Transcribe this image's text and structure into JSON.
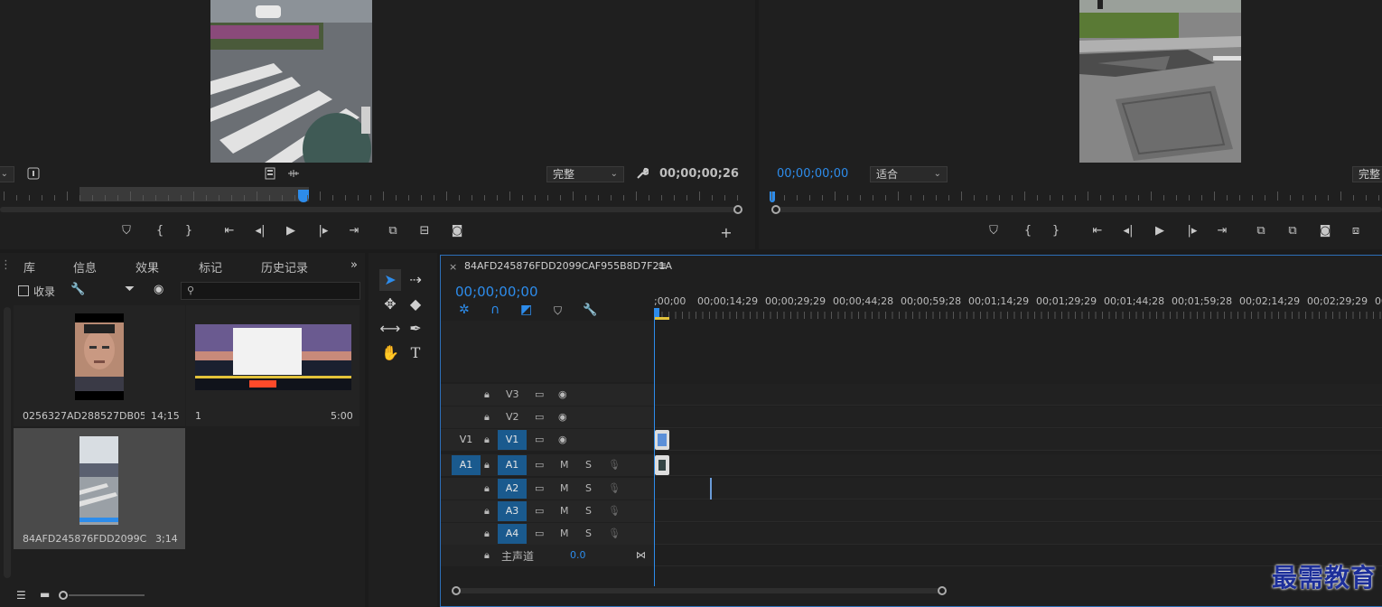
{
  "source_monitor": {
    "timecode": "00;00;00;26",
    "zoom": "完整"
  },
  "program_monitor": {
    "timecode": "00;00;00;00",
    "zoom": "适合",
    "zoom_right": "完整"
  },
  "project_panel": {
    "tabs": [
      "库",
      "信息",
      "效果",
      "标记",
      "历史记录"
    ],
    "toolbar": {
      "checkbox_label": "收录",
      "search_placeholder": ""
    },
    "items": [
      {
        "name": "0256327AD288527DB05...",
        "duration": "14;15"
      },
      {
        "name": "1",
        "duration": "5:00"
      },
      {
        "name": "84AFD245876FDD2099CA...",
        "duration": "3;14"
      }
    ]
  },
  "timeline": {
    "sequence_name": "84AFD245876FDD2099CAF955B8D7F21A",
    "timecode": "00;00;00;00",
    "ruler_labels": [
      ";00;00",
      "00;00;14;29",
      "00;00;29;29",
      "00;00;44;28",
      "00;00;59;28",
      "00;01;14;29",
      "00;01;29;29",
      "00;01;44;28",
      "00;01;59;28",
      "00;02;14;29",
      "00;02;29;29",
      "00;"
    ],
    "video_tracks": [
      {
        "source": "",
        "name": "V3"
      },
      {
        "source": "",
        "name": "V2"
      },
      {
        "source": "V1",
        "name": "V1"
      }
    ],
    "audio_tracks": [
      {
        "source": "A1",
        "name": "A1",
        "m": "M",
        "s": "S"
      },
      {
        "source": "",
        "name": "A2",
        "m": "M",
        "s": "S"
      },
      {
        "source": "",
        "name": "A3",
        "m": "M",
        "s": "S"
      },
      {
        "source": "",
        "name": "A4",
        "m": "M",
        "s": "S"
      }
    ],
    "master": {
      "label": "主声道",
      "value": "0.0"
    }
  },
  "watermark": "最需教育",
  "colors": {
    "accent": "#2d8ceb",
    "track_on": "#1a5a8e",
    "panel": "#1f1f1f"
  }
}
